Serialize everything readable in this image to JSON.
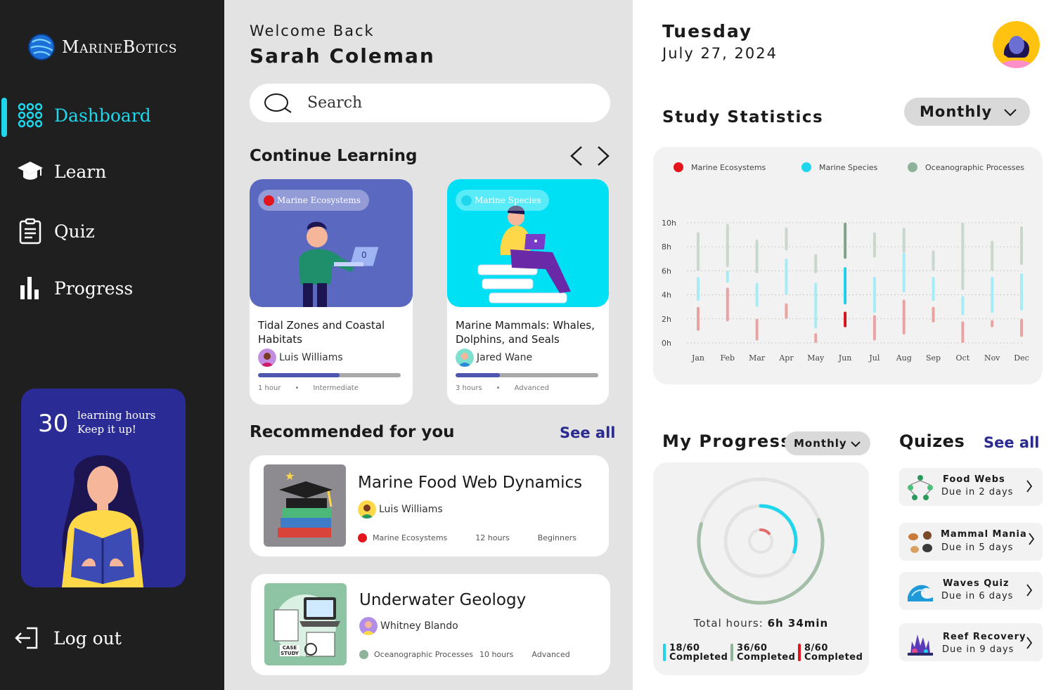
{
  "brand": {
    "name": "MarineBotics"
  },
  "sidebar": {
    "items": [
      {
        "label": "Dashboard",
        "icon": "dashboard-grid-icon",
        "active": true
      },
      {
        "label": "Learn",
        "icon": "graduation-cap-icon"
      },
      {
        "label": "Quiz",
        "icon": "clipboard-icon"
      },
      {
        "label": "Progress",
        "icon": "bar-chart-icon"
      }
    ],
    "promo": {
      "hours": "30",
      "line1": "learning hours",
      "line2": "Keep it up!"
    },
    "logout_label": "Log out"
  },
  "header": {
    "welcome": "Welcome Back",
    "user_name": "Sarah Coleman"
  },
  "search": {
    "placeholder": "Search"
  },
  "continue_learning": {
    "title": "Continue Learning",
    "courses": [
      {
        "tag": "Marine Ecosystems",
        "tag_color": "#e3141b",
        "title": "Tidal Zones and Coastal Habitats",
        "author": "Luis Williams",
        "progress": 0.57,
        "duration": "1 hour",
        "level": "Intermediate",
        "art_badge": "0"
      },
      {
        "tag": "Marine Species",
        "tag_color": "#1fd6ec",
        "title": "Marine Mammals: Whales, Dolphins, and Seals",
        "author": "Jared Wane",
        "progress": 0.31,
        "duration": "3 hours",
        "level": "Advanced"
      }
    ]
  },
  "recommended": {
    "title": "Recommended for you",
    "see_all": "See all",
    "courses": [
      {
        "title": "Marine Food Web Dynamics",
        "author": "Luis Williams",
        "category": "Marine Ecosystems",
        "category_color": "#e3141b",
        "duration": "12 hours",
        "level": "Beginners"
      },
      {
        "title": "Underwater Geology",
        "author": "Whitney Blando",
        "category": "Oceanographic Processes",
        "category_color": "#8fb39a",
        "duration": "10 hours",
        "level": "Advanced",
        "thumb_text": "CASE STUDY"
      }
    ]
  },
  "date_header": {
    "day": "Tuesday",
    "date": "July 27, 2024"
  },
  "study_statistics": {
    "title": "Study Statistics",
    "period": "Monthly"
  },
  "chart_data": {
    "type": "bar",
    "title": "Study Statistics",
    "categories": [
      "Jan",
      "Feb",
      "Mar",
      "Apr",
      "May",
      "Jun",
      "Jul",
      "Aug",
      "Sep",
      "Oct",
      "Nov",
      "Dec"
    ],
    "y_ticks": [
      "0h",
      "2h",
      "4h",
      "6h",
      "8h",
      "10h"
    ],
    "ylim": [
      0,
      10
    ],
    "legend_position": "top",
    "series": [
      {
        "name": "Marine Ecosystems",
        "color": "#e3141b",
        "ranges": [
          [
            1,
            3
          ],
          [
            1.8,
            4.6
          ],
          [
            0.2,
            2
          ],
          [
            2,
            3.3
          ],
          [
            0,
            0.8
          ],
          [
            1.3,
            2.6
          ],
          [
            0.2,
            2.3
          ],
          [
            0.7,
            3.6
          ],
          [
            1.7,
            3
          ],
          [
            0,
            1.8
          ],
          [
            1.3,
            1.9
          ],
          [
            0.5,
            2
          ]
        ]
      },
      {
        "name": "Marine Species",
        "color": "#1fd6ec",
        "ranges": [
          [
            3.5,
            5.5
          ],
          [
            5,
            6
          ],
          [
            3,
            5
          ],
          [
            4,
            7
          ],
          [
            1.2,
            5
          ],
          [
            3.2,
            6.3
          ],
          [
            2.5,
            5.5
          ],
          [
            4.2,
            7.5
          ],
          [
            3.5,
            5.5
          ],
          [
            2.3,
            3.9
          ],
          [
            2.5,
            5.5
          ],
          [
            2.7,
            5.8
          ]
        ]
      },
      {
        "name": "Oceanographic Processes",
        "color": "#8fb39a",
        "ranges": [
          [
            6,
            9.2
          ],
          [
            6.3,
            9.9
          ],
          [
            5.8,
            8.6
          ],
          [
            7.7,
            9.6
          ],
          [
            5.8,
            7.4
          ],
          [
            7,
            10
          ],
          [
            7.1,
            9.2
          ],
          [
            7.5,
            9.6
          ],
          [
            6,
            7.7
          ],
          [
            4.4,
            10
          ],
          [
            6,
            8.5
          ],
          [
            6.5,
            9.7
          ]
        ]
      }
    ]
  },
  "my_progress": {
    "title": "My Progress",
    "period": "Monthly",
    "total_label": "Total hours:",
    "total_value": "6h 34min",
    "rings": [
      {
        "name": "Oceanographic Processes",
        "fraction": 0.6,
        "color": "#a4bea7"
      },
      {
        "name": "Marine Species",
        "fraction": 0.3,
        "color": "#1fd6ec"
      },
      {
        "name": "Marine Ecosystems",
        "fraction": 0.133,
        "color": "#e66a6a"
      }
    ],
    "stats": [
      {
        "value": "18/60",
        "label": "Completed",
        "color": "#1fd6ec"
      },
      {
        "value": "36/60",
        "label": "Completed",
        "color": "#8fb39a"
      },
      {
        "value": "8/60",
        "label": "Completed",
        "color": "#e3141b"
      }
    ]
  },
  "quizzes": {
    "title": "Quizes",
    "see_all": "See all",
    "items": [
      {
        "name": "Food Webs",
        "due": "Due in 2 days"
      },
      {
        "name": "Mammal Mania",
        "due": "Due in 5 days"
      },
      {
        "name": "Waves Quiz",
        "due": "Due in 6 days"
      },
      {
        "name": "Reef Recovery",
        "due": "Due in 9 days"
      }
    ]
  }
}
